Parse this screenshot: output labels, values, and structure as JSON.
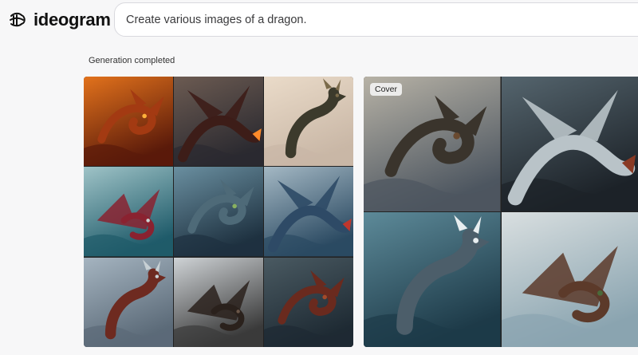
{
  "brand": {
    "name": "ideogram",
    "logo_icon": "ideogram-logo-icon"
  },
  "search": {
    "value": "Create various images of a dragon."
  },
  "status": {
    "text": "Generation completed"
  },
  "gallery_a": {
    "tiles": [
      {
        "bg1": "#5a1a0a",
        "bg2": "#e2721c",
        "dragon": "#a33a12",
        "accent": "#ffb03a",
        "alt": "fire-breathing-dragon"
      },
      {
        "bg1": "#2b2a30",
        "bg2": "#6c5b52",
        "dragon": "#3d1d18",
        "accent": "#ff8a2a",
        "alt": "roaring-red-dragon"
      },
      {
        "bg1": "#c9b7a6",
        "bg2": "#eadbc9",
        "dragon": "#3c3a2c",
        "accent": "#7a6a4a",
        "alt": "flying-dragon-sunset"
      },
      {
        "bg1": "#1f5b6a",
        "bg2": "#9fc3c7",
        "dragon": "#8a2230",
        "accent": "#c9d6d3",
        "alt": "red-winged-dragon"
      },
      {
        "bg1": "#1e3140",
        "bg2": "#6a8fa0",
        "dragon": "#4e6a78",
        "accent": "#88b060",
        "alt": "grey-dragon-field"
      },
      {
        "bg1": "#2b4a62",
        "bg2": "#a4b8c4",
        "dragon": "#2e4a66",
        "accent": "#c0362c",
        "alt": "blue-dragon-roaring"
      },
      {
        "bg1": "#5b6a78",
        "bg2": "#a5b4c0",
        "dragon": "#6e2a20",
        "accent": "#c7d0d4",
        "alt": "dragon-over-cliffs"
      },
      {
        "bg1": "#3a3a3a",
        "bg2": "#cfd3d6",
        "dragon": "#2a211c",
        "accent": "#6a5648",
        "alt": "dark-horned-dragon"
      },
      {
        "bg1": "#1e2a33",
        "bg2": "#4a5a62",
        "dragon": "#6a2a1e",
        "accent": "#a44a2a",
        "alt": "red-dragon-portrait"
      }
    ]
  },
  "gallery_b": {
    "badge": "Cover",
    "tiles": [
      {
        "bg1": "#4d5660",
        "bg2": "#b7b2a6",
        "dragon": "#3a342c",
        "accent": "#6a4a30",
        "alt": "dragon-over-castle"
      },
      {
        "bg1": "#1c2228",
        "bg2": "#55656e",
        "dragon": "#b9c3c8",
        "accent": "#8a3a24",
        "alt": "white-horned-dragon"
      },
      {
        "bg1": "#1d3a48",
        "bg2": "#5d8a99",
        "dragon": "#4c5e6a",
        "accent": "#e8eef0",
        "alt": "sea-dragon-waves"
      },
      {
        "bg1": "#8aa4b0",
        "bg2": "#d9dfe0",
        "dragon": "#5c3a2a",
        "accent": "#4a6a3a",
        "alt": "dragon-on-mountain"
      }
    ]
  }
}
